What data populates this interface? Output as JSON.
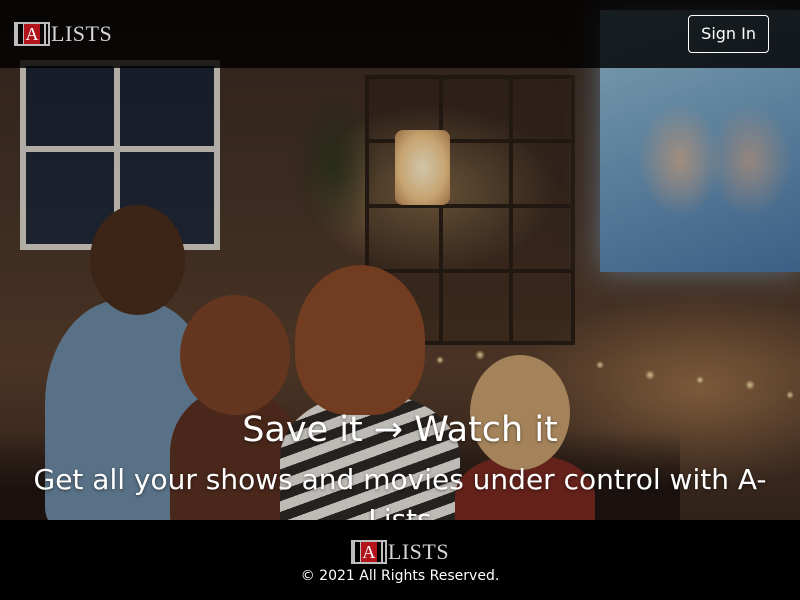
{
  "header": {
    "logo": {
      "mark_letter": "A",
      "text": "LISTS"
    },
    "signin_label": "Sign In"
  },
  "hero": {
    "title": "Save it → Watch it",
    "subtitle": "Get all your shows and movies under control with A-Lists"
  },
  "footer": {
    "logo": {
      "mark_letter": "A",
      "text": "LISTS"
    },
    "copyright": "© 2021 All Rights Reserved."
  },
  "colors": {
    "header_bg": "#000000",
    "logo_red": "#b3141c",
    "logo_gray": "#bdbdbd",
    "text_white": "#ffffff",
    "footer_bg": "#000000"
  }
}
